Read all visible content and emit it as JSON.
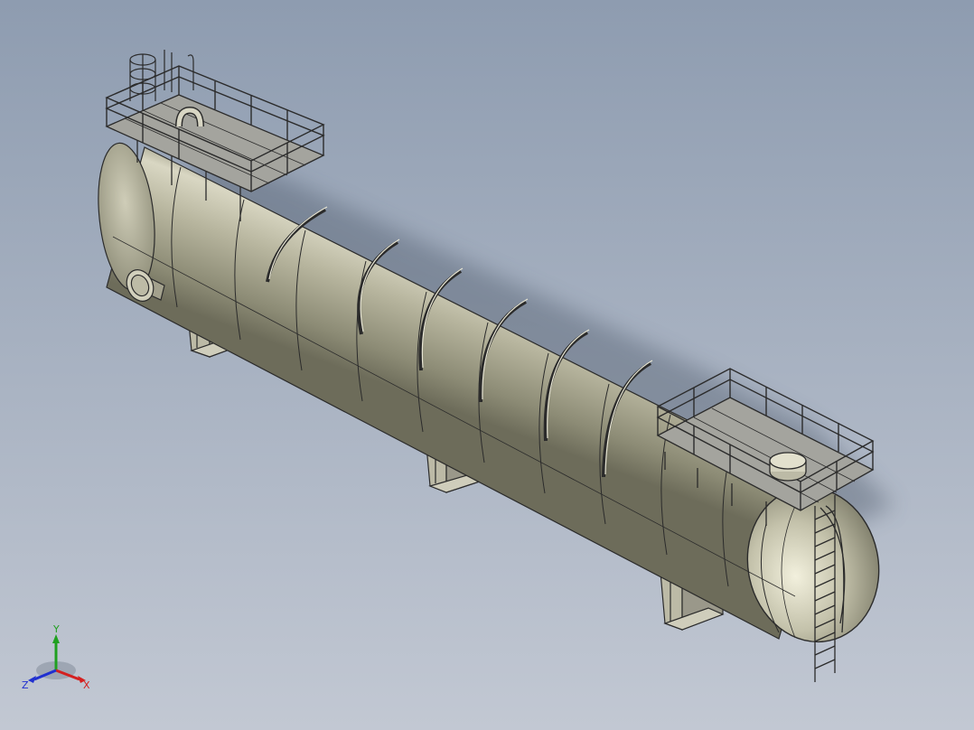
{
  "viewport": {
    "background_top": "#8e9cb0",
    "background_bottom": "#c2c8d3",
    "model": "horizontal-pressure-vessel"
  },
  "colors": {
    "vessel_body": "#b5b39a",
    "vessel_light": "#e4e2cf",
    "vessel_dark": "#6f6e5c",
    "steel": "#2b2b2b",
    "platform_deck": "#9a9a94"
  },
  "triad": {
    "x_label": "X",
    "y_label": "Y",
    "z_label": "Z",
    "x_color": "#d42020",
    "y_color": "#20a020",
    "z_color": "#2030d0"
  }
}
